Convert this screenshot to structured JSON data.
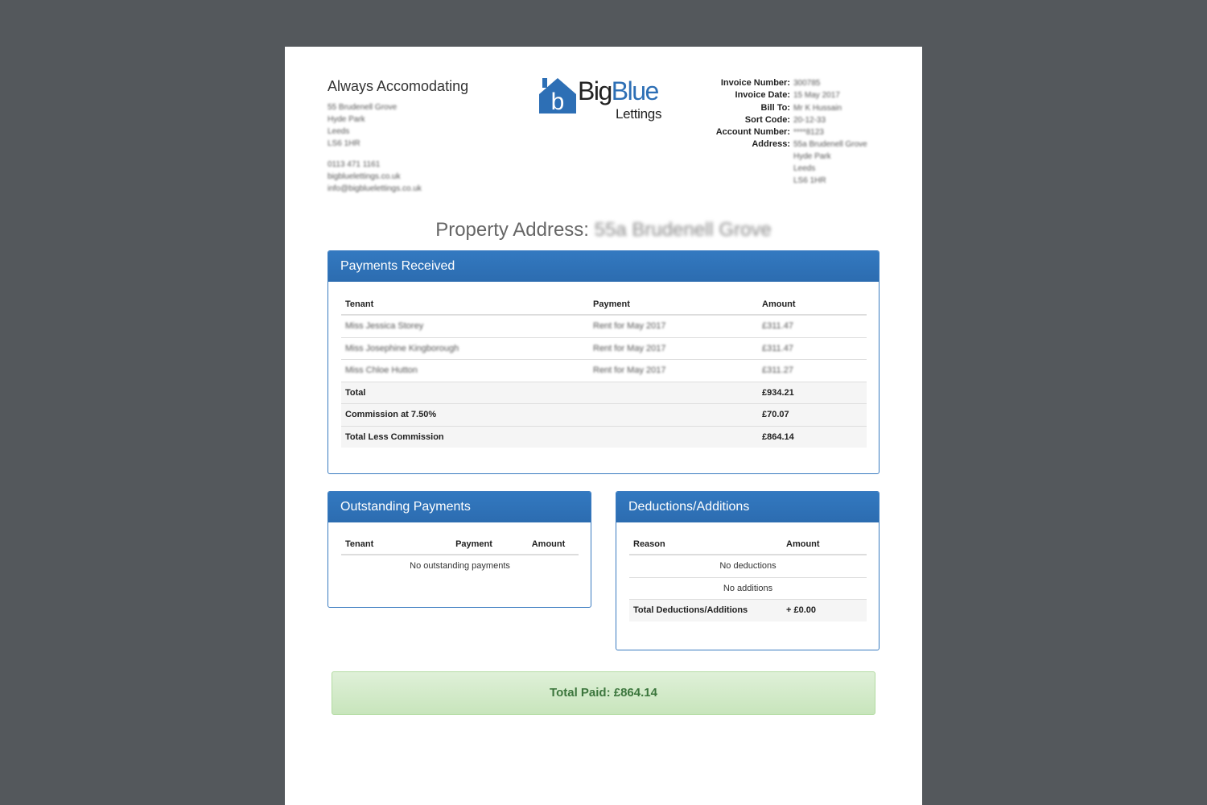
{
  "company": {
    "name": "Always Accomodating",
    "address_lines": [
      "55 Brudenell Grove",
      "Hyde Park",
      "Leeds",
      "LS6 1HR"
    ],
    "contact_lines": [
      "0113 471 1161",
      "bigbluelettings.co.uk",
      "info@bigbluelettings.co.uk"
    ]
  },
  "logo": {
    "big": "BigBlue",
    "small": "Lettings",
    "letter": "b",
    "color": "#2d6fb5"
  },
  "invoice": {
    "labels": {
      "number": "Invoice Number:",
      "date": "Invoice Date:",
      "bill_to": "Bill To:",
      "sort_code": "Sort Code:",
      "account_number": "Account Number:",
      "address": "Address:"
    },
    "number": "300785",
    "date": "15 May 2017",
    "bill_to": "Mr K Hussain",
    "sort_code": "20-12-33",
    "account_number": "****8123",
    "address_lines": [
      "55a Brudenell Grove",
      "Hyde Park",
      "Leeds",
      "LS6 1HR"
    ]
  },
  "property": {
    "label": "Property Address:",
    "value": "55a Brudenell Grove"
  },
  "payments_received": {
    "title": "Payments Received",
    "headers": [
      "Tenant",
      "Payment",
      "Amount"
    ],
    "rows": [
      {
        "tenant": "Miss Jessica Storey",
        "payment": "Rent for May 2017",
        "amount": "£311.47"
      },
      {
        "tenant": "Miss Josephine Kingborough",
        "payment": "Rent for May 2017",
        "amount": "£311.47"
      },
      {
        "tenant": "Miss Chloe Hutton",
        "payment": "Rent for May 2017",
        "amount": "£311.27"
      }
    ],
    "total_label": "Total",
    "total": "£934.21",
    "commission_label": "Commission at 7.50%",
    "commission": "£70.07",
    "less_label": "Total Less Commission",
    "less": "£864.14"
  },
  "outstanding": {
    "title": "Outstanding Payments",
    "headers": [
      "Tenant",
      "Payment",
      "Amount"
    ],
    "empty": "No outstanding payments"
  },
  "deductions": {
    "title": "Deductions/Additions",
    "headers": [
      "Reason",
      "Amount"
    ],
    "no_deductions": "No deductions",
    "no_additions": "No additions",
    "total_label": "Total Deductions/Additions",
    "total": "+ £0.00"
  },
  "total_paid": "Total Paid: £864.14"
}
